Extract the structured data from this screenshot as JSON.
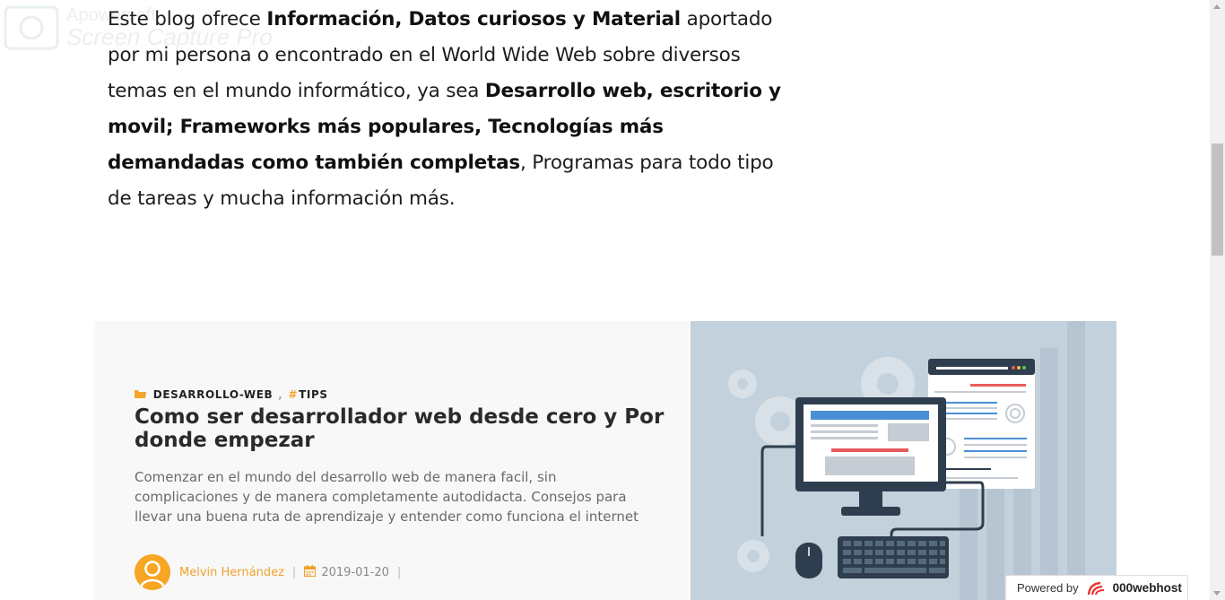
{
  "watermark": {
    "line1": "Apowersoft",
    "line2": "Screen Capture Pro"
  },
  "intro": {
    "p1": "Este blog ofrece ",
    "b1": "Información, Datos curiosos y Material",
    "p2": " aportado por mi persona o encontrado en el World Wide Web sobre diversos temas en el mundo informático, ya sea ",
    "b2": "Desarrollo web, escritorio y movil; Frameworks más populares, Tecnologías más demandadas como también completas",
    "p3": ", Programas para todo tipo de tareas y mucha información más."
  },
  "post": {
    "category1": "DESARROLLO-WEB",
    "separator": ",",
    "category2": "TIPS",
    "title": "Como ser desarrollador web desde cero y Por donde empezar",
    "excerpt": "Comenzar en el mundo del desarrollo web de manera facil, sin complicaciones y de manera completamente autodidacta. Consejos para llevar una buena ruta de aprendizaje y entender como funciona el internet",
    "author": "Melvin Hernández",
    "date": "2019-01-20",
    "pipe": "|"
  },
  "footer_badge": {
    "prefix": "Powered by",
    "brand": "000webhost"
  },
  "colors": {
    "accent": "#f4a52b",
    "image_bg": "#c3d1dc",
    "monitor": "#2f3e4e",
    "blue_bar": "#4a8fd6",
    "red_bar": "#e85b5b"
  }
}
